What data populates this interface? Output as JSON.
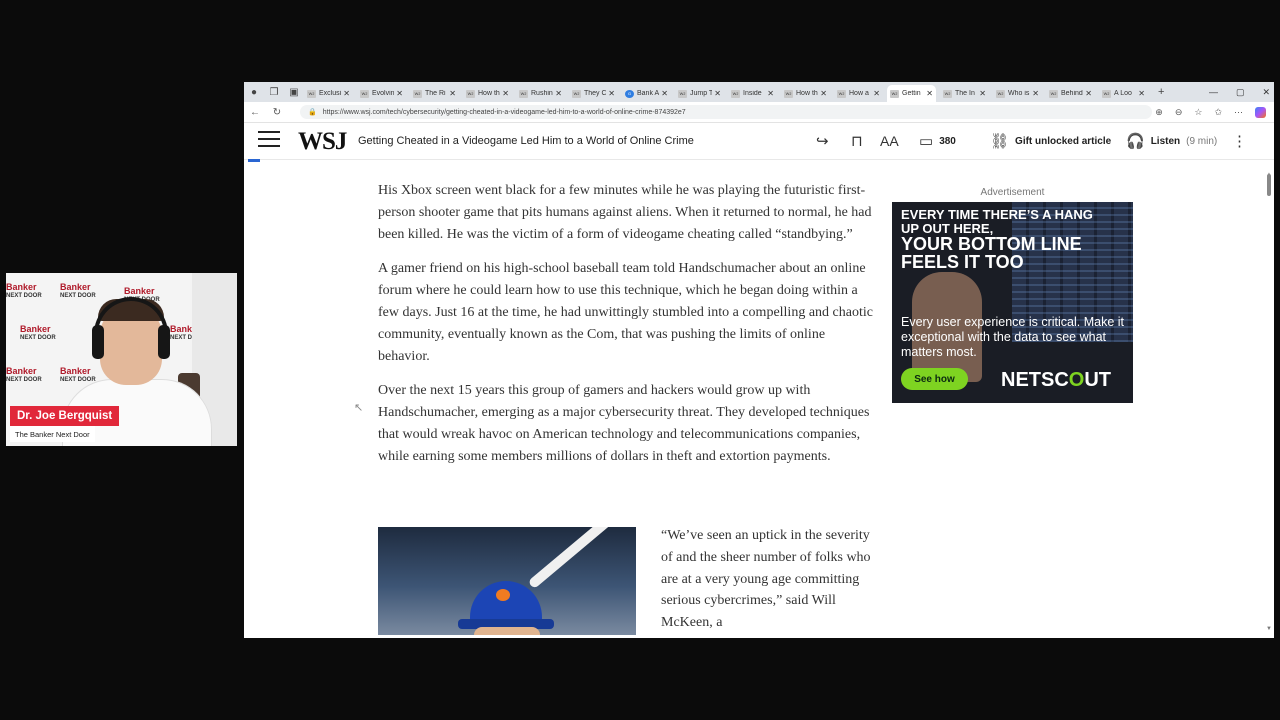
{
  "browser": {
    "tabs": [
      {
        "label": "Exclusi",
        "active": false
      },
      {
        "label": "Evolvin",
        "active": false
      },
      {
        "label": "The Ri",
        "active": false
      },
      {
        "label": "How th",
        "active": false
      },
      {
        "label": "Rushin",
        "active": false
      },
      {
        "label": "They C",
        "active": false
      },
      {
        "label": "Bank A",
        "active": false,
        "google": true
      },
      {
        "label": "Jump T",
        "active": false
      },
      {
        "label": "Inside",
        "active": false
      },
      {
        "label": "How th",
        "active": false
      },
      {
        "label": "How a",
        "active": false
      },
      {
        "label": "Gettin",
        "active": true
      },
      {
        "label": "The In",
        "active": false
      },
      {
        "label": "Who is",
        "active": false
      },
      {
        "label": "Behind",
        "active": false
      },
      {
        "label": "A Loo",
        "active": false
      }
    ],
    "favicon_text": "WJ",
    "url": "https://www.wsj.com/tech/cybersecurity/getting-cheated-in-a-videogame-led-him-to-a-world-of-online-crime-874392e7"
  },
  "header": {
    "logo": "WSJ",
    "title": "Getting Cheated in a Videogame Led Him to a World of Online Crime",
    "comments_count": "380",
    "gift_label": "Gift unlocked article",
    "listen_label": "Listen",
    "listen_duration": "(9 min)"
  },
  "article": {
    "paragraphs": [
      "His Xbox screen went black for a few minutes while he was playing the futuristic first-person shooter game that pits humans against aliens. When it returned to normal, he had been killed. He was the victim of a form of videogame cheating called “standbying.”",
      "A gamer friend on his high-school baseball team told Handschumacher about an online forum where he could learn how to use this technique, which he began doing within a few days. Just 16 at the time, he had unwittingly stumbled into a compelling and chaotic community, eventually known as the Com, that was pushing the limits of online behavior.",
      "Over the next 15 years this group of gamers and hackers would grow up with Handschumacher, emerging as a major cybersecurity threat. They developed techniques that would wreak havoc on American technology and telecommunications companies, while earning some members millions of dollars in theft and extortion payments."
    ],
    "quote": "“We’ve seen an uptick in the severity of and the sheer number of folks who are at a very young age committing serious cybercrimes,” said Will McKeen, a"
  },
  "ad": {
    "label": "Advertisement",
    "headline_small": "EVERY TIME THERE’S A HANG UP OUT HERE,",
    "headline_big": "YOUR BOTTOM LINE FEELS IT TOO",
    "sub": "Every user experience is critical. Make it exceptional with the data to see what matters most.",
    "cta": "See how",
    "brand_a": "NETSC",
    "brand_b": "O",
    "brand_c": "UT"
  },
  "webcam": {
    "watermark_top": "Banker",
    "watermark_bottom": "NEXT DOOR",
    "name": "Dr. Joe Bergquist",
    "show": "The Banker Next Door"
  },
  "colors": {
    "name_plate": "#e1283a",
    "ad_cta": "#7ed321",
    "progress": "#2a66d2"
  }
}
